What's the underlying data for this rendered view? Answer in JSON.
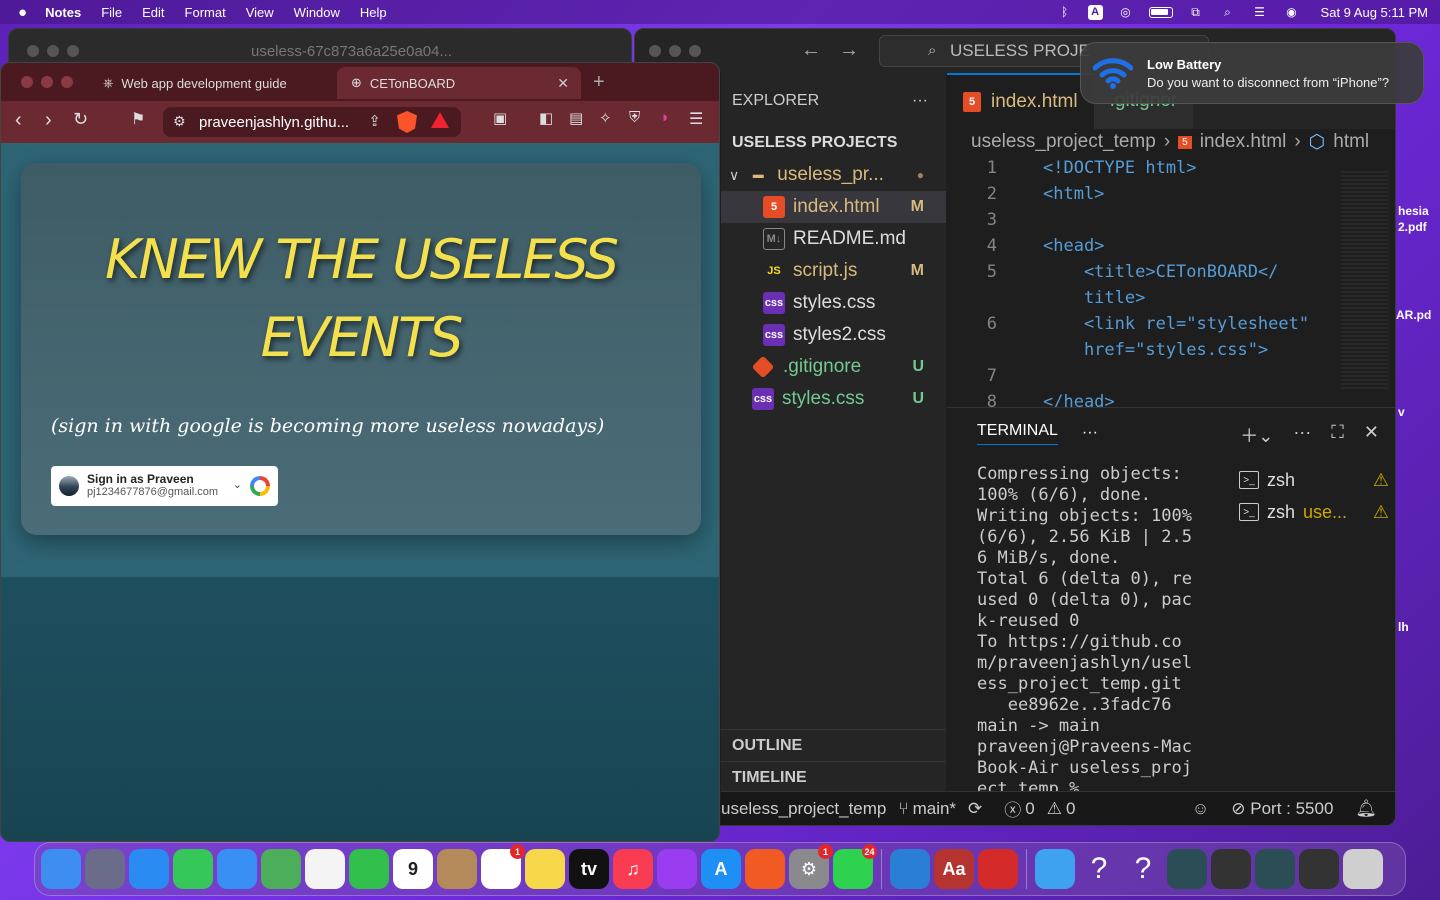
{
  "menubar": {
    "app": "Notes",
    "items": [
      "File",
      "Edit",
      "Format",
      "View",
      "Window",
      "Help"
    ],
    "input_source": "A",
    "datetime": "Sat 9 Aug  5:11 PM"
  },
  "bg_window": {
    "title": "useless-67c873a6a25e0a04..."
  },
  "notification": {
    "title": "Low Battery",
    "body": "Do you want to disconnect from “iPhone”?"
  },
  "desktop_labels": [
    "hesia",
    "2.pdf",
    "AR.pd",
    "v",
    "lh"
  ],
  "browser": {
    "tabs": [
      {
        "label": "Web app development guide"
      },
      {
        "label": "CETonBOARD"
      }
    ],
    "url": "praveenjashlyn.githu...",
    "page": {
      "title_line1": "KNEW THE USELESS",
      "title_line2": "EVENTS",
      "tagline": "(sign in with google is becoming more useless nowadays)",
      "signin": {
        "name": "Sign in as Praveen",
        "email": "pj1234677876@gmail.com"
      }
    }
  },
  "vscode": {
    "search": "USELESS PROJE",
    "explorer_label": "EXPLORER",
    "project_label": "USELESS PROJECTS",
    "tree": [
      {
        "name": "useless_pr...",
        "icon": "folder-icon",
        "status": "●",
        "type": "folder"
      },
      {
        "name": "index.html",
        "icon": "html-icon",
        "status": "M",
        "type": "file"
      },
      {
        "name": "README.md",
        "icon": "markdown-icon",
        "status": "",
        "type": "file"
      },
      {
        "name": "script.js",
        "icon": "js-icon",
        "status": "M",
        "type": "file"
      },
      {
        "name": "styles.css",
        "icon": "css-icon",
        "status": "",
        "type": "file"
      },
      {
        "name": "styles2.css",
        "icon": "css-icon",
        "status": "",
        "type": "file"
      },
      {
        "name": ".gitignore",
        "icon": "git-icon",
        "status": "U",
        "type": "file"
      },
      {
        "name": "styles.css",
        "icon": "css-icon",
        "status": "U",
        "type": "file"
      }
    ],
    "outline_label": "OUTLINE",
    "timeline_label": "TIMELINE",
    "active_tab": "index.html",
    "inactive_tab": ".gitignor",
    "breadcrumbs": [
      "useless_project_temp",
      "index.html",
      "html"
    ],
    "code": [
      {
        "n": "1",
        "text": "<!DOCTYPE html>"
      },
      {
        "n": "2",
        "text": "<html>"
      },
      {
        "n": "3",
        "text": ""
      },
      {
        "n": "4",
        "text": "<head>"
      },
      {
        "n": "5",
        "text": "    <title>CETonBOARD</"
      },
      {
        "n": "",
        "text": "    title>"
      },
      {
        "n": "6",
        "text": "    <link rel=\"stylesheet\""
      },
      {
        "n": "",
        "text": "    href=\"styles.css\">"
      },
      {
        "n": "7",
        "text": ""
      },
      {
        "n": "8",
        "text": "</head>"
      }
    ],
    "terminal_label": "TERMINAL",
    "terminal_output": "Compressing objects: 100% (6/6), done.\nWriting objects: 100% (6/6), 2.56 KiB | 2.56 MiB/s, done.\nTotal 6 (delta 0), reused 0 (delta 0), pack-reused 0\nTo https://github.com/praveenjashlyn/useless_project_temp.git\n   ee8962e..3fadc76  main -> main\npraveenj@Praveens-MacBook-Air useless_project_temp % ",
    "terminals": [
      {
        "name": "zsh",
        "sub": ""
      },
      {
        "name": "zsh",
        "sub": "use..."
      }
    ],
    "status": {
      "folder": "useless_project_temp",
      "branch": "main*",
      "errors": "0",
      "warnings": "0",
      "port": "Port : 5500"
    }
  },
  "dock": {
    "apps": [
      {
        "name": "finder-icon",
        "label": "",
        "color": "#3d8ef0"
      },
      {
        "name": "launchpad-icon",
        "label": "",
        "color": "#6b6b8a"
      },
      {
        "name": "safari-icon",
        "label": "",
        "color": "#2a8bf2"
      },
      {
        "name": "messages-icon",
        "label": "",
        "color": "#35c759"
      },
      {
        "name": "mail-icon",
        "label": "",
        "color": "#3a8ff5"
      },
      {
        "name": "maps-icon",
        "label": "",
        "color": "#4cae5a"
      },
      {
        "name": "photos-icon",
        "label": "",
        "color": "#f4f4f4"
      },
      {
        "name": "facetime-icon",
        "label": "",
        "color": "#30c04b"
      },
      {
        "name": "calendar-icon",
        "label": "9",
        "color": "#ffffff"
      },
      {
        "name": "contacts-icon",
        "label": "",
        "color": "#b48a5a"
      },
      {
        "name": "reminders-icon",
        "label": "",
        "color": "#ffffff",
        "badge": "1"
      },
      {
        "name": "notes-icon",
        "label": "",
        "color": "#f7d84a"
      },
      {
        "name": "appletv-icon",
        "label": "tv",
        "color": "#111111"
      },
      {
        "name": "music-icon",
        "label": "♫",
        "color": "#fa3c52"
      },
      {
        "name": "podcasts-icon",
        "label": "",
        "color": "#9a3cf0"
      },
      {
        "name": "appstore-icon",
        "label": "A",
        "color": "#1e90f5"
      },
      {
        "name": "brave-icon",
        "label": "",
        "color": "#f25a24"
      },
      {
        "name": "settings-icon",
        "label": "⚙",
        "color": "#8a8a8e",
        "badge": "1"
      },
      {
        "name": "whatsapp-icon",
        "label": "",
        "color": "#2fd24f",
        "badge": "24"
      },
      {
        "name": "vscode-icon",
        "label": "",
        "color": "#2a7fd4"
      },
      {
        "name": "dictionary-icon",
        "label": "Aa",
        "color": "#b5342f"
      },
      {
        "name": "pdf-viewer-icon",
        "label": "",
        "color": "#d42a2a"
      },
      {
        "name": "folder-icon",
        "label": "",
        "color": "#3ea2f0"
      },
      {
        "name": "unknown-app-icon",
        "label": "?",
        "color": "transparent"
      },
      {
        "name": "unknown-app-icon-2",
        "label": "?",
        "color": "transparent"
      },
      {
        "name": "window-thumb-1",
        "label": "",
        "color": "#2b4d55"
      },
      {
        "name": "window-thumb-2",
        "label": "",
        "color": "#333333"
      },
      {
        "name": "window-thumb-3",
        "label": "",
        "color": "#2b4d55"
      },
      {
        "name": "window-thumb-4",
        "label": "",
        "color": "#333333"
      },
      {
        "name": "trash-icon",
        "label": "",
        "color": "#cfcfcf"
      }
    ]
  },
  "colors": {
    "title_yellow": "#f4e04d",
    "vscode_accent": "#0078d4",
    "modified": "#d7ba7d",
    "untracked": "#73c991"
  }
}
